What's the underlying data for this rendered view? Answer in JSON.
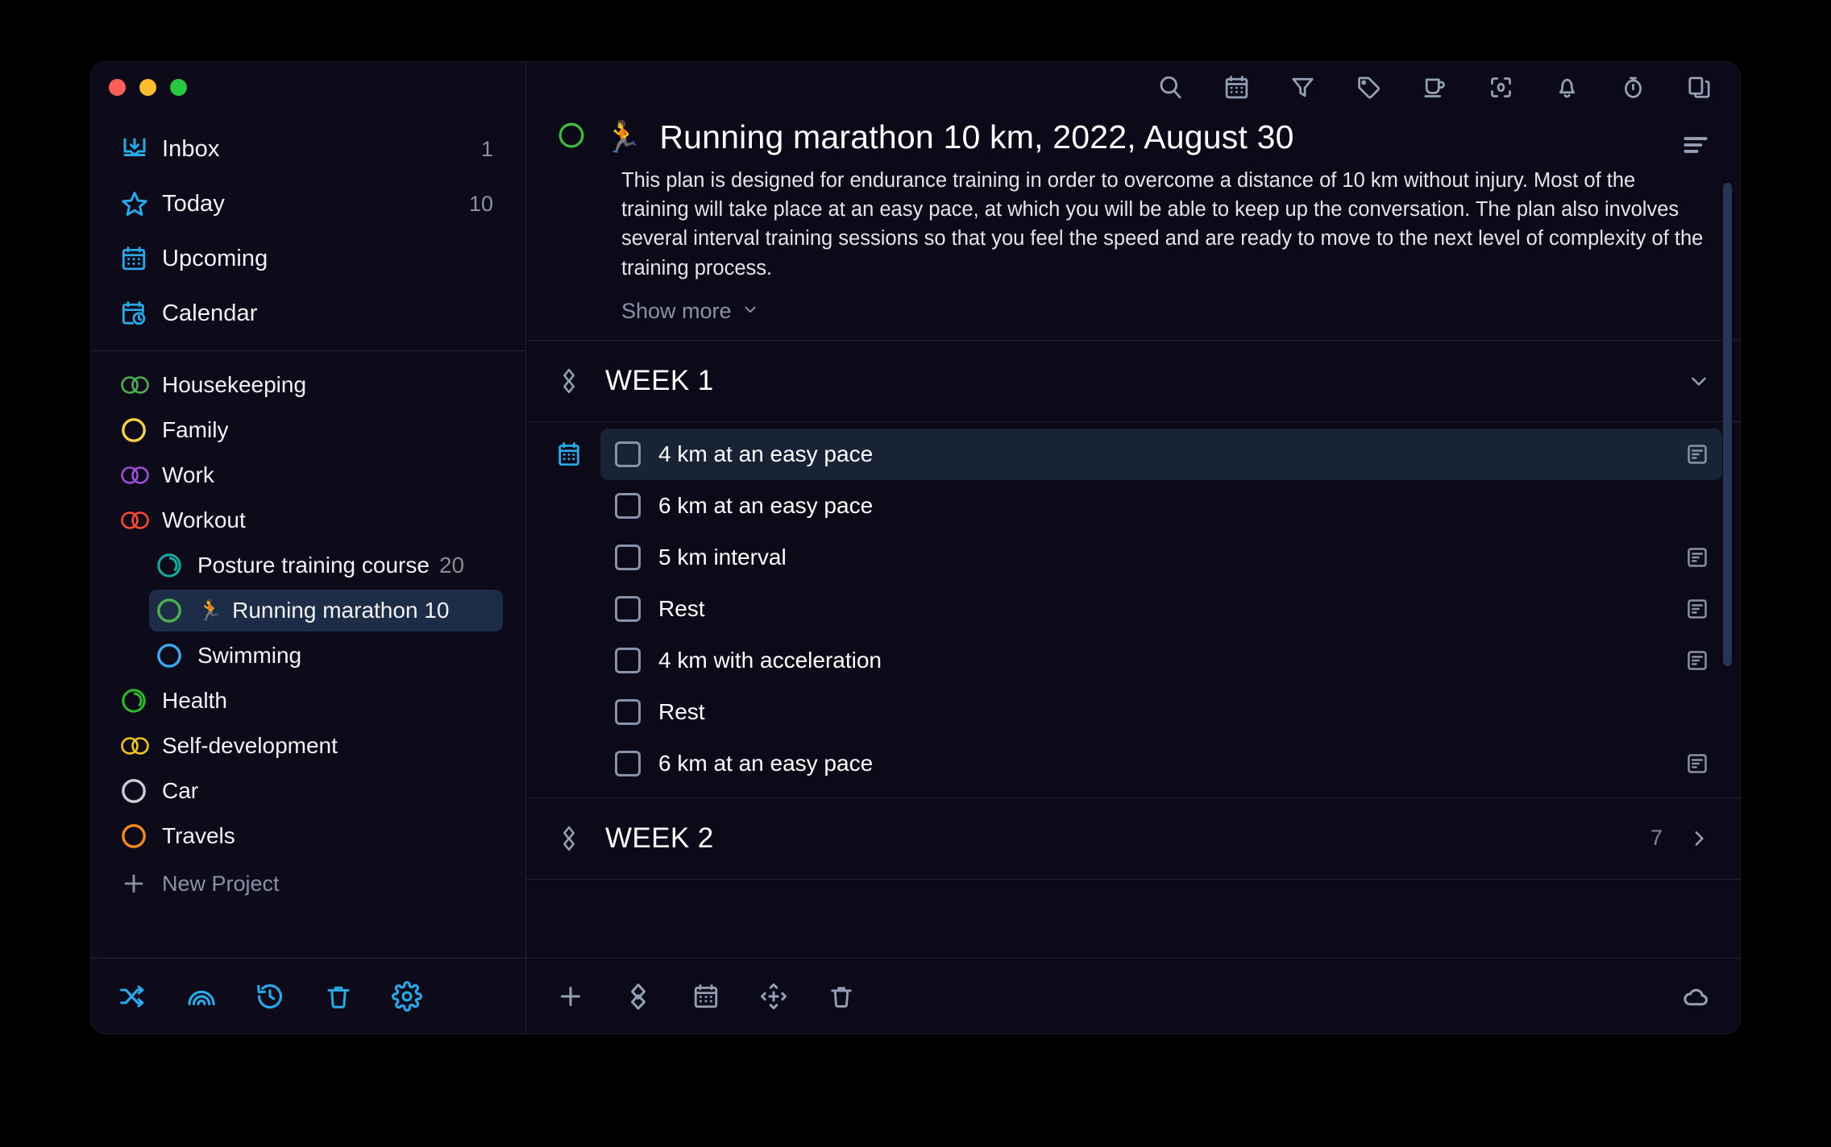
{
  "window": {
    "traffic_lights": [
      "close",
      "minimize",
      "maximize"
    ],
    "colors": {
      "close": "#FF5F57",
      "minimize": "#FEBC2E",
      "maximize": "#28C840",
      "accent": "#2BA8E8",
      "selected_row": "#182336",
      "sidebar_selected": "#1E2D47"
    }
  },
  "sidebar": {
    "nav": [
      {
        "label": "Inbox",
        "count": "1",
        "icon": "inbox-icon"
      },
      {
        "label": "Today",
        "count": "10",
        "icon": "star-icon"
      },
      {
        "label": "Upcoming",
        "count": "",
        "icon": "calendar-grid-icon"
      },
      {
        "label": "Calendar",
        "count": "",
        "icon": "calendar-clock-icon"
      }
    ],
    "projects": [
      {
        "label": "Housekeeping",
        "color": "#4CAF50",
        "shape": "double",
        "sub": false,
        "selected": false,
        "emoji": ""
      },
      {
        "label": "Family",
        "color": "#F3D14E",
        "shape": "single",
        "sub": false,
        "selected": false,
        "emoji": ""
      },
      {
        "label": "Work",
        "color": "#9B4FD8",
        "shape": "double",
        "sub": false,
        "selected": false,
        "emoji": ""
      },
      {
        "label": "Workout",
        "color": "#FF4A32",
        "shape": "double",
        "sub": false,
        "selected": false,
        "emoji": ""
      },
      {
        "label": "Posture training course",
        "truncated": "20",
        "color": "#13A89E",
        "shape": "progress",
        "sub": true,
        "selected": false,
        "emoji": ""
      },
      {
        "label": "Running marathon 10",
        "truncated": "",
        "color": "#4CAF50",
        "shape": "single",
        "sub": true,
        "selected": true,
        "emoji": "🏃"
      },
      {
        "label": "Swimming",
        "color": "#3BA8F0",
        "shape": "single",
        "sub": true,
        "selected": false,
        "emoji": ""
      },
      {
        "label": "Health",
        "color": "#2EB82E",
        "shape": "progress",
        "sub": false,
        "selected": false,
        "emoji": ""
      },
      {
        "label": "Self-development",
        "color": "#F5C518",
        "shape": "double",
        "sub": false,
        "selected": false,
        "emoji": ""
      },
      {
        "label": "Car",
        "color": "#C9CDD6",
        "shape": "single",
        "sub": false,
        "selected": false,
        "emoji": ""
      },
      {
        "label": "Travels",
        "color": "#F08A1E",
        "shape": "single",
        "sub": false,
        "selected": false,
        "emoji": ""
      }
    ],
    "new_project_label": "New Project",
    "footer_icons": [
      "shuffle-icon",
      "rainbow-icon",
      "history-icon",
      "trash-icon",
      "gear-icon"
    ]
  },
  "main": {
    "toolbar_icons": [
      "search-icon",
      "calendar-icon",
      "filter-icon",
      "tag-icon",
      "mug-icon",
      "focus-icon",
      "bell-icon",
      "stopwatch-icon",
      "duplicate-icon"
    ],
    "project": {
      "emoji": "🏃",
      "title": "Running marathon 10 km, 2022, August 30",
      "circle_color": "#3DBA3D",
      "description": "This plan is designed for endurance training in order to overcome a distance of 10 km without injury. Most of the training will take place at an easy pace, at which you will be able to keep up the conversation. The plan also involves several interval training sessions so that you feel the speed and are ready to move to the next level of complexity of the training process.",
      "show_more_label": "Show more"
    },
    "sections": [
      {
        "title": "WEEK 1",
        "count": "",
        "expanded": true,
        "tasks": [
          {
            "label": "4 km at an easy pace",
            "has_note": true,
            "has_date": true,
            "selected": true
          },
          {
            "label": "6 km at an easy pace",
            "has_note": false,
            "has_date": false,
            "selected": false
          },
          {
            "label": "5 km interval",
            "has_note": true,
            "has_date": false,
            "selected": false
          },
          {
            "label": "Rest",
            "has_note": true,
            "has_date": false,
            "selected": false
          },
          {
            "label": "4 km with acceleration",
            "has_note": true,
            "has_date": false,
            "selected": false
          },
          {
            "label": "Rest",
            "has_note": false,
            "has_date": false,
            "selected": false
          },
          {
            "label": "6 km at an easy pace",
            "has_note": true,
            "has_date": false,
            "selected": false
          }
        ]
      },
      {
        "title": "WEEK 2",
        "count": "7",
        "expanded": false,
        "tasks": []
      }
    ],
    "footer_icons": [
      "plus-icon",
      "heading-icon",
      "calendar-icon",
      "move-icon",
      "trash-icon"
    ],
    "cloud_icon": "cloud-icon"
  }
}
